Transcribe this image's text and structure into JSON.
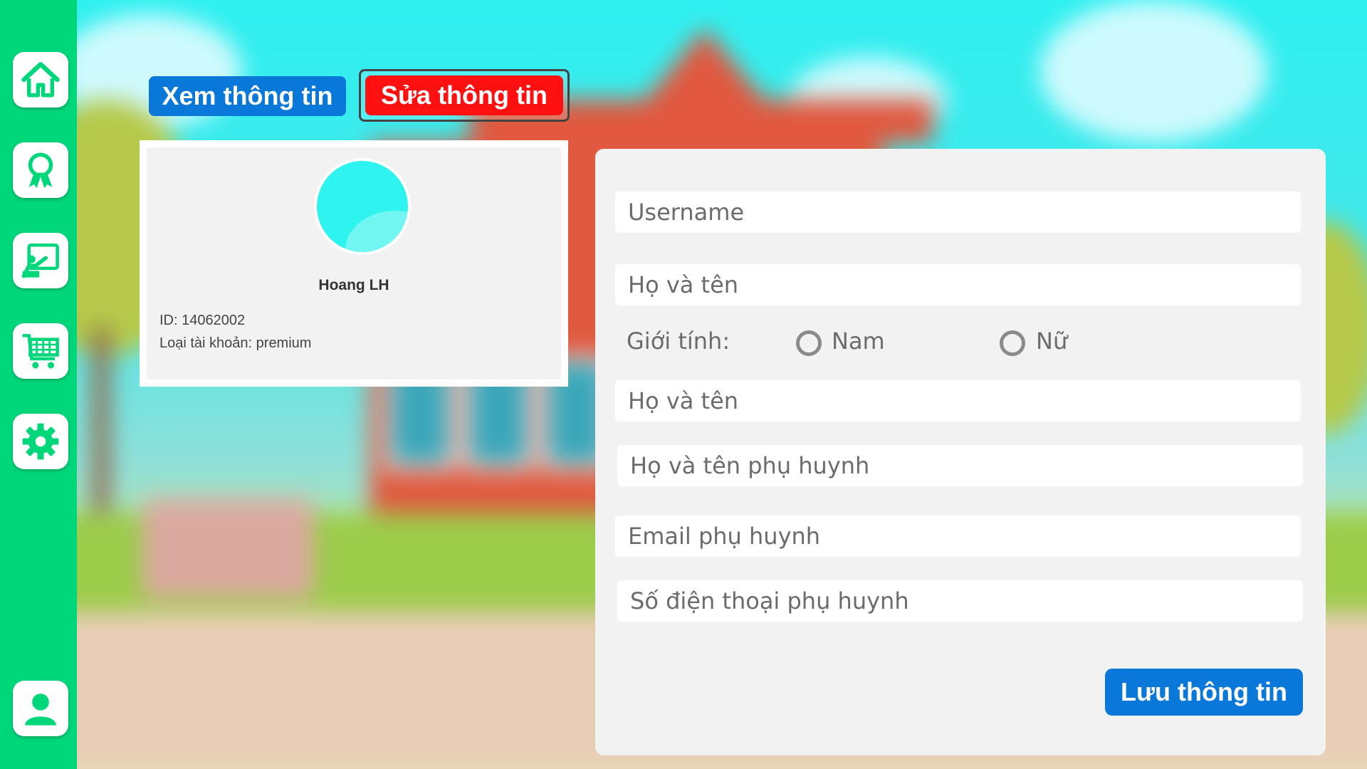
{
  "sidebar": {
    "items": [
      {
        "icon": "home-icon"
      },
      {
        "icon": "award-ribbon-icon"
      },
      {
        "icon": "teacher-board-icon"
      },
      {
        "icon": "shopping-cart-icon"
      },
      {
        "icon": "gear-icon"
      },
      {
        "icon": "user-icon"
      }
    ],
    "color": "#00d67a"
  },
  "tabs": {
    "view_label": "Xem thông tin",
    "edit_label": "Sửa thông tin",
    "view_color": "#0a78d8",
    "edit_color": "#ff1010",
    "active": "edit"
  },
  "profile": {
    "name": "Hoang LH",
    "id_line": "ID: 14062002",
    "account_type_line": "Loại tài khoản: premium"
  },
  "form": {
    "username_placeholder": "Username",
    "fullname_placeholder": "Họ và tên",
    "gender_label": "Giới tính:",
    "gender_options": [
      "Nam",
      "Nữ"
    ],
    "fullname2_placeholder": "Họ và tên",
    "parent_name_placeholder": "Họ và tên phụ huynh",
    "parent_email_placeholder": "Email phụ huynh",
    "parent_phone_placeholder": "Số điện thoại phụ huynh",
    "save_label": "Lưu thông tin"
  }
}
